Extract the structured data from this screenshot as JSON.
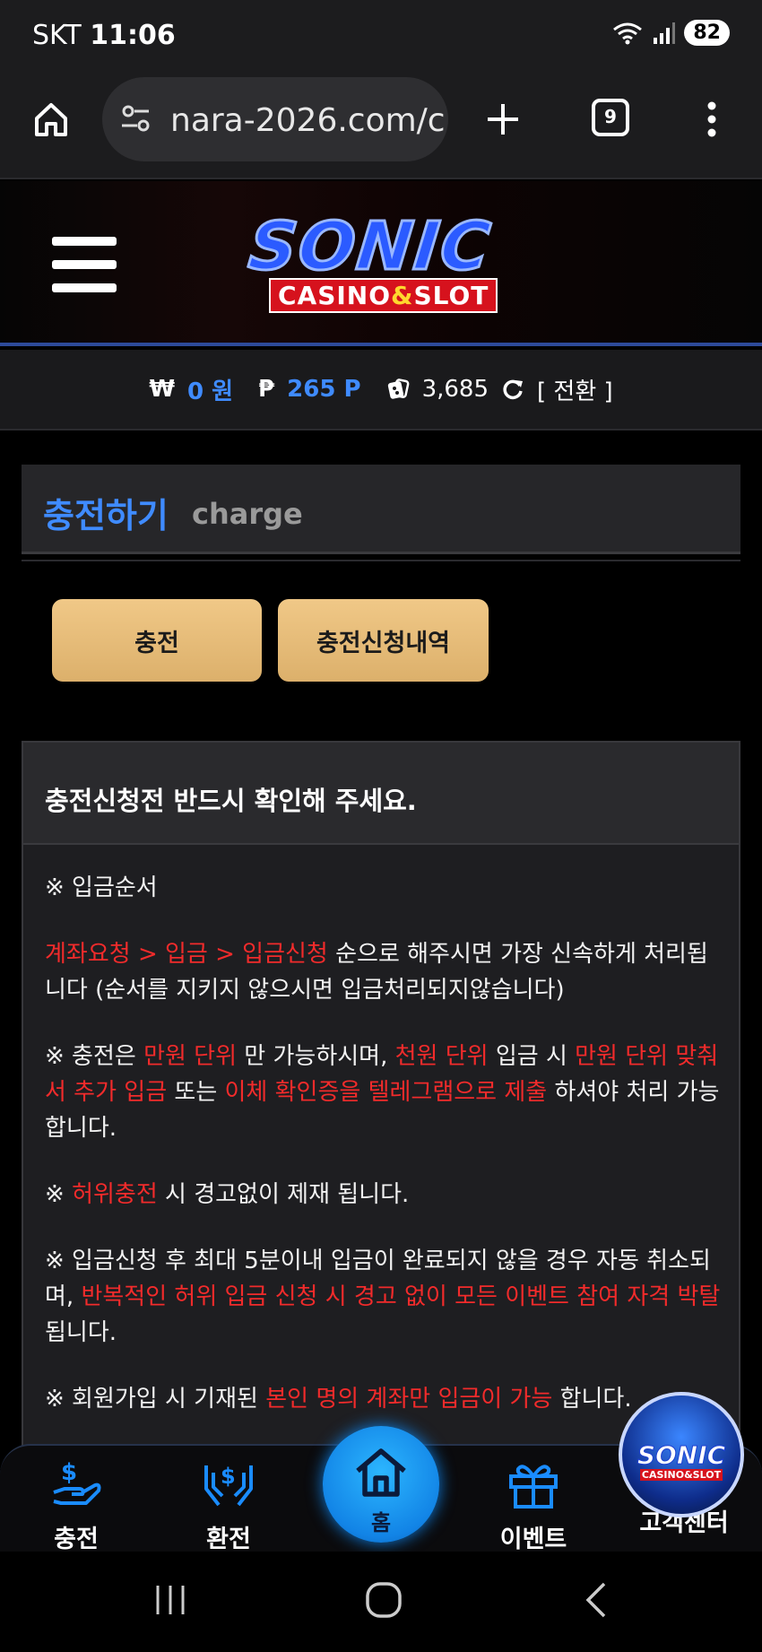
{
  "status_bar": {
    "carrier": "SKT",
    "time": "11:06",
    "battery": "82"
  },
  "browser": {
    "url": "nara-2026.com/c",
    "tab_count": "9",
    "icons": [
      "home-icon",
      "tune-icon",
      "plus-icon",
      "tabs-icon",
      "more-icon"
    ]
  },
  "site": {
    "logo_top": "SONIC",
    "logo_bottom_a": "CASINO",
    "logo_bottom_amp": "&",
    "logo_bottom_b": "SLOT"
  },
  "balance": {
    "won_symbol": "₩",
    "won_value": "0",
    "won_unit": "원",
    "point_symbol": "₱",
    "point_value": "265",
    "point_unit": "P",
    "chips": "3,685",
    "convert_label": "[ 전환 ]"
  },
  "charge": {
    "title_ko": "충전하기",
    "title_en": "charge",
    "button_charge": "충전",
    "button_history": "충전신청내역"
  },
  "notice": {
    "heading": "충전신청전 반드시 확인해 주세요.",
    "p1": "※ 입금순서",
    "p2_red": "계좌요청 > 입금 > 입금신청",
    "p2_rest": " 순으로 해주시면 가장 신속하게 처리됩니다 (순서를 지키지 않으시면 입금처리되지않습니다)",
    "p3_a": "※ 충전은 ",
    "p3_b": "만원 단위",
    "p3_c": " 만 가능하시며, ",
    "p3_d": "천원 단위",
    "p3_e": " 입금 시 ",
    "p3_f": "만원 단위 맞춰서 추가 입금",
    "p3_g": " 또는 ",
    "p3_h": "이체 확인증을 텔레그램으로 제출",
    "p3_i": " 하셔야 처리 가능합니다.",
    "p4_a": "※ ",
    "p4_b": "허위충전",
    "p4_c": " 시 경고없이 제재 됩니다.",
    "p5_a": "※ 입금신청 후 최대 5분이내 입금이 완료되지 않을 경우 자동 취소되며, ",
    "p5_b": "반복적인 허위 입금 신청 시 경고 없이 모든 이벤트 참여 자격 박탈",
    "p5_c": "됩니다.",
    "p6_a": "※ 회원가입 시 기재된 ",
    "p6_b": "본인 명의 계좌만 입금이 가능",
    "p6_c": " 합니다."
  },
  "bottom_nav": {
    "charge": "충전",
    "exchange": "환전",
    "home": "홈",
    "event": "이벤트",
    "support": "고객센터"
  },
  "badge": {
    "top": "SONIC",
    "bottom": "CASINO&SLOT"
  },
  "colors": {
    "accent_blue": "#3f8bff",
    "gold_button": "#e8bd79",
    "warning_red": "#f22b2b",
    "background": "#000000"
  }
}
